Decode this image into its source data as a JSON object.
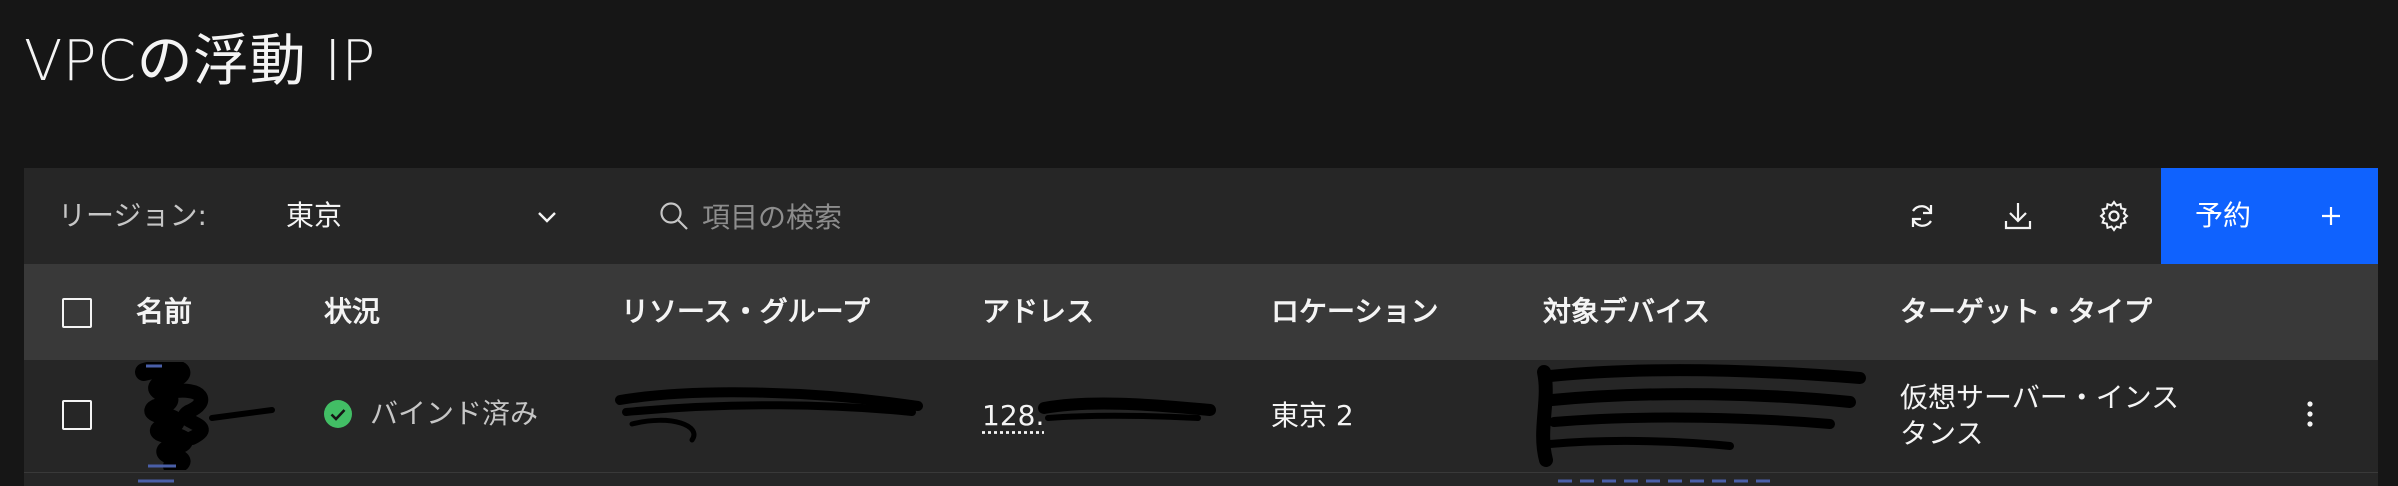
{
  "page": {
    "title": "VPCの浮動 IP"
  },
  "toolbar": {
    "region_label": "リージョン:",
    "region_value": "東京",
    "search_placeholder": "項目の検索",
    "reserve_label": "予約",
    "icons": [
      "refresh-icon",
      "download-icon",
      "settings-icon",
      "add-icon"
    ]
  },
  "table": {
    "headers": [
      "名前",
      "状況",
      "リソース・グループ",
      "アドレス",
      "ロケーション",
      "対象デバイス",
      "ターゲット・タイプ"
    ],
    "rows": [
      {
        "name": "",
        "status": "バインド済み",
        "status_color": "#42be65",
        "resource_group": "",
        "address": "128.",
        "location": "東京 2",
        "target_device": "",
        "target_type_line1": "仮想サーバー・インス",
        "target_type_line2": "タンス"
      }
    ]
  },
  "colors": {
    "background": "#161616",
    "panel": "#262626",
    "header": "#393939",
    "primary": "#0f62fe",
    "link": "#78a9ff"
  }
}
